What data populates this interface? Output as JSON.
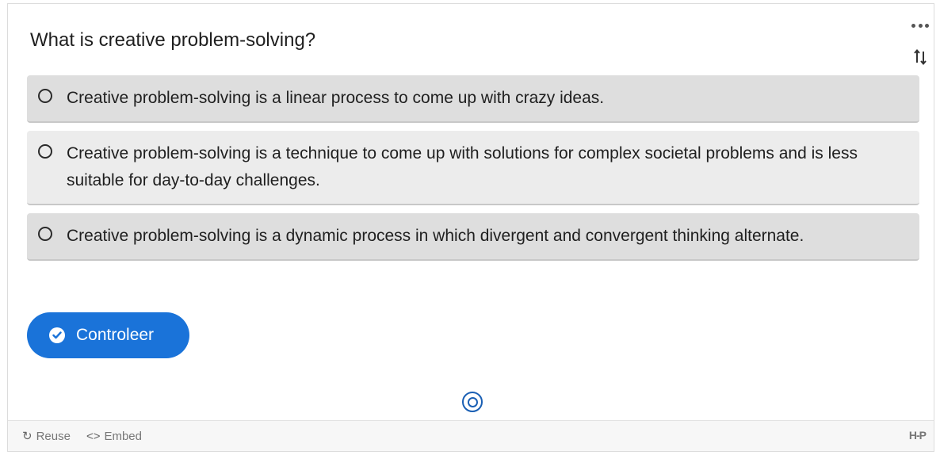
{
  "question": "What is creative problem-solving?",
  "toolbar": {
    "more_icon": "more-horizontal-icon",
    "sort_icon": "sort-arrows-icon"
  },
  "options": [
    {
      "text": "Creative problem-solving is a linear process to come up with crazy ideas.",
      "selected": false
    },
    {
      "text": "Creative problem-solving is a technique to come up with solutions for complex societal problems and is less suitable for day-to-day challenges.",
      "selected": false
    },
    {
      "text": "Creative problem-solving is a dynamic process in which divergent and convergent thinking alternate.",
      "selected": false
    }
  ],
  "check_button": {
    "label": "Controleer",
    "icon": "check-circle-icon",
    "color": "#1a73d9"
  },
  "progress": {
    "current": 1,
    "total": 1
  },
  "footer": {
    "reuse_label": "Reuse",
    "reuse_icon": "refresh-icon",
    "embed_label": "Embed",
    "embed_icon": "code-icon",
    "logo": "H-P"
  }
}
